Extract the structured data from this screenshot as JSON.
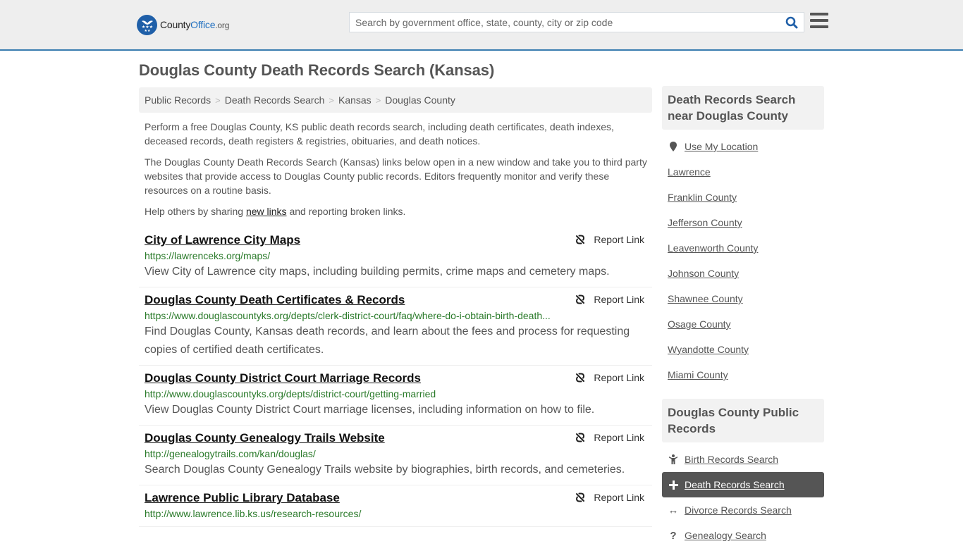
{
  "header": {
    "logo": {
      "name_part1": "County",
      "name_part2": "Office",
      "tld": ".org"
    },
    "search": {
      "placeholder": "Search by government office, state, county, city or zip code",
      "value": ""
    },
    "brand_color": "#1f5fa8",
    "accent_border_color": "#3a7db0"
  },
  "page": {
    "title": "Douglas County Death Records Search (Kansas)",
    "breadcrumb": [
      "Public Records",
      "Death Records Search",
      "Kansas",
      "Douglas County"
    ],
    "intro": {
      "p1": "Perform a free Douglas County, KS public death records search, including death certificates, death indexes, deceased records, death registers & registries, obituaries, and death notices.",
      "p2": "The Douglas County Death Records Search (Kansas) links below open in a new window and take you to third party websites that provide access to Douglas County public records. Editors frequently monitor and verify these resources on a routine basis.",
      "p3_before": "Help others by sharing ",
      "p3_link": "new links",
      "p3_after": " and reporting broken links."
    },
    "report_label": "Report Link",
    "results": [
      {
        "title": "City of Lawrence City Maps",
        "url": "https://lawrenceks.org/maps/",
        "desc": "View City of Lawrence city maps, including building permits, crime maps and cemetery maps."
      },
      {
        "title": "Douglas County Death Certificates & Records",
        "url": "https://www.douglascountyks.org/depts/clerk-district-court/faq/where-do-i-obtain-birth-death...",
        "desc": "Find Douglas County, Kansas death records, and learn about the fees and process for requesting copies of certified death certificates."
      },
      {
        "title": "Douglas County District Court Marriage Records",
        "url": "http://www.douglascountyks.org/depts/district-court/getting-married",
        "desc": "View Douglas County District Court marriage licenses, including information on how to file."
      },
      {
        "title": "Douglas County Genealogy Trails Website",
        "url": "http://genealogytrails.com/kan/douglas/",
        "desc": "Search Douglas County Genealogy Trails website by biographies, birth records, and cemeteries."
      },
      {
        "title": "Lawrence Public Library Database",
        "url": "http://www.lawrence.lib.ks.us/research-resources/",
        "desc": ""
      }
    ]
  },
  "sidebar": {
    "nearby": {
      "heading": "Death Records Search near Douglas County",
      "use_location": "Use My Location",
      "items": [
        "Lawrence",
        "Franklin County",
        "Jefferson County",
        "Leavenworth County",
        "Johnson County",
        "Shawnee County",
        "Osage County",
        "Wyandotte County",
        "Miami County"
      ]
    },
    "public_records": {
      "heading": "Douglas County Public Records",
      "items": [
        {
          "label": "Birth Records Search",
          "icon": "child-icon",
          "active": false
        },
        {
          "label": "Death Records Search",
          "icon": "plus-icon",
          "active": true
        },
        {
          "label": "Divorce Records Search",
          "icon": "arrows-horizontal-icon",
          "active": false
        },
        {
          "label": "Genealogy Search",
          "icon": "question-icon",
          "active": false
        }
      ]
    }
  }
}
